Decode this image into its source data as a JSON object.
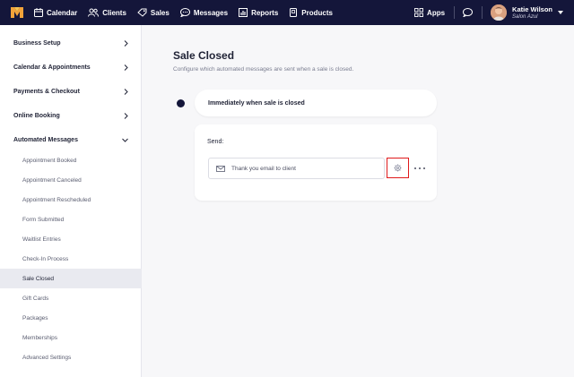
{
  "colors": {
    "nav_bg": "#14163a",
    "highlight": "#e0191b",
    "active_bg": "#e9eaf0"
  },
  "nav": {
    "items": [
      {
        "label": "Calendar",
        "icon": "calendar-icon"
      },
      {
        "label": "Clients",
        "icon": "clients-icon"
      },
      {
        "label": "Sales",
        "icon": "tag-icon"
      },
      {
        "label": "Messages",
        "icon": "chat-icon"
      },
      {
        "label": "Reports",
        "icon": "bar-chart-icon"
      },
      {
        "label": "Products",
        "icon": "box-icon"
      }
    ],
    "apps_label": "Apps",
    "user_name": "Katie Wilson",
    "user_salon": "Salon Azul"
  },
  "sidebar": {
    "sections": [
      {
        "label": "Business Setup",
        "expanded": false
      },
      {
        "label": "Calendar & Appointments",
        "expanded": false
      },
      {
        "label": "Payments & Checkout",
        "expanded": false
      },
      {
        "label": "Online Booking",
        "expanded": false
      },
      {
        "label": "Automated Messages",
        "expanded": true
      }
    ],
    "sub_items": [
      "Appointment Booked",
      "Appointment Canceled",
      "Appointment Rescheduled",
      "Form Submitted",
      "Waitlist Entries",
      "Check-In Process",
      "Sale Closed",
      "Gift Cards",
      "Packages",
      "Memberships",
      "Advanced Settings"
    ],
    "active_sub": "Sale Closed"
  },
  "main": {
    "title": "Sale Closed",
    "subtitle": "Configure which automated messages are sent when a sale is closed.",
    "trigger_label": "Immediately when sale is closed",
    "send_label": "Send:",
    "message_value": "Thank you email to client"
  }
}
